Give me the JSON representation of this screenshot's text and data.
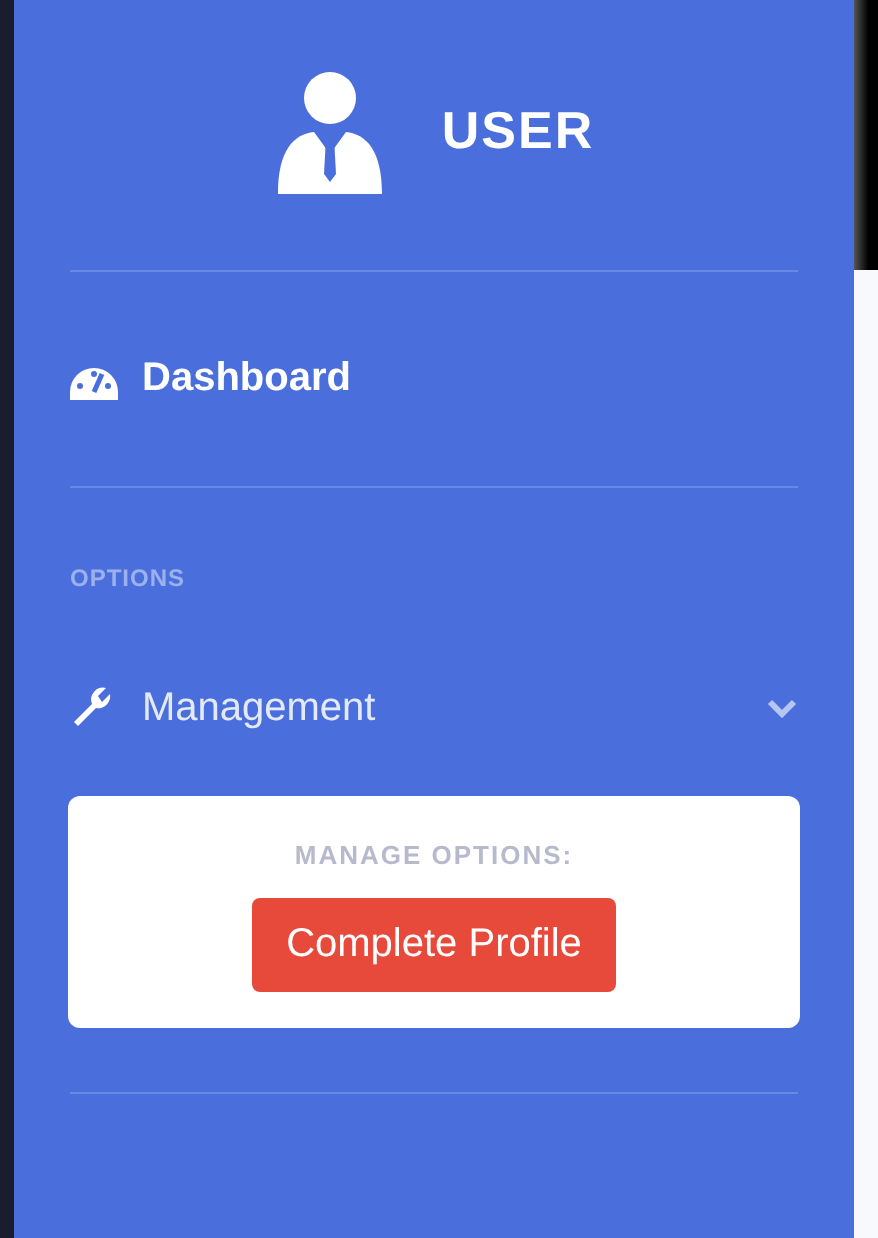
{
  "brand": {
    "title": "USER"
  },
  "nav": [
    {
      "kind": "link",
      "label": "Dashboard"
    },
    {
      "kind": "heading",
      "label": "OPTIONS"
    },
    {
      "kind": "collapse",
      "label": "Management",
      "expanded": true,
      "panel": {
        "heading": "MANAGE OPTIONS:",
        "button": "Complete Profile"
      }
    }
  ]
}
